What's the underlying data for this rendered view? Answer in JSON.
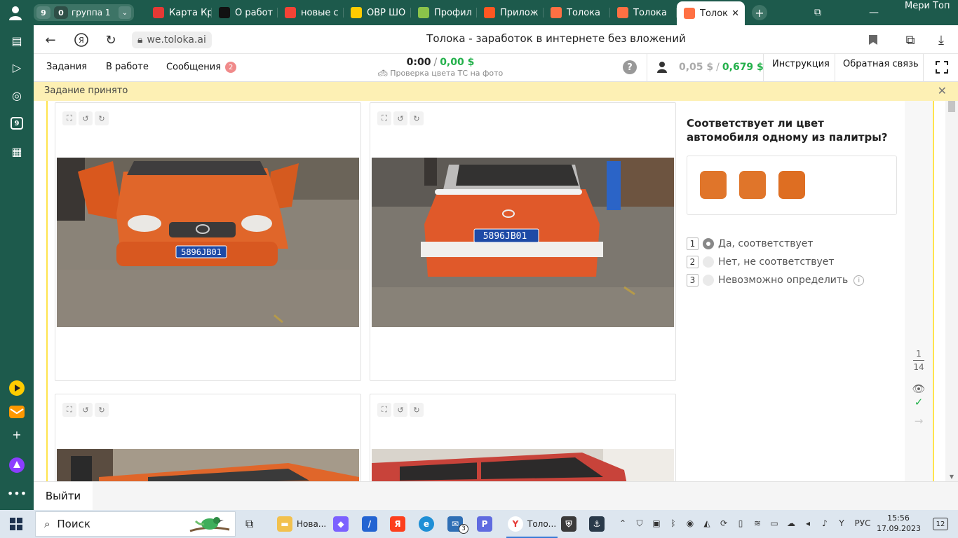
{
  "browser": {
    "profile_name": "Мери Топ",
    "tab_group": {
      "count": "9",
      "tabs_in_group": "0",
      "name": "группа 1"
    },
    "tabs": [
      {
        "label": "Карта Кр",
        "favicon": "map-pin-icon",
        "color": "#e53935"
      },
      {
        "label": "О работ",
        "favicon": "star-icon",
        "color": "#111111"
      },
      {
        "label": "новые с",
        "favicon": "yandex-icon",
        "color": "#f44336"
      },
      {
        "label": "ОВР ШО",
        "favicon": "play-icon",
        "color": "#ffcc00"
      },
      {
        "label": "Профил",
        "favicon": "question-icon",
        "color": "#8bc34a"
      },
      {
        "label": "Прилож",
        "favicon": "toloka-icon",
        "color": "#ff5722"
      },
      {
        "label": "Толока",
        "favicon": "toloka-icon",
        "color": "#ff7043"
      },
      {
        "label": "Толока",
        "favicon": "toloka-icon",
        "color": "#ff7043"
      },
      {
        "label": "Толок",
        "favicon": "toloka-icon",
        "color": "#ff7043",
        "active": true
      }
    ],
    "address": {
      "domain": "we.toloka.ai",
      "page_title": "Толока - заработок в интернете без вложений"
    },
    "rail_badge": "9"
  },
  "toloka": {
    "nav": {
      "tasks": "Задания",
      "in_work": "В работе",
      "messages": "Сообщения",
      "messages_count": "2"
    },
    "timer": {
      "time": "0:00",
      "separator": "/",
      "reward": "0,00 $",
      "task_name": "Проверка цвета ТС на фото"
    },
    "balance": {
      "pending": "0,05 $",
      "separator": "/",
      "available": "0,679 $"
    },
    "links": {
      "instruction": "Инструкция",
      "feedback": "Обратная связь"
    },
    "notice": "Задание принято",
    "question": "Соответствует ли цвет автомобиля одному из палитры?",
    "palette": [
      "#e0752a",
      "#e0752a",
      "#de6e22"
    ],
    "options": [
      {
        "key": "1",
        "label": "Да, соответствует",
        "selected": true
      },
      {
        "key": "2",
        "label": "Нет, не соответствует",
        "selected": false
      },
      {
        "key": "3",
        "label": "Невозможно определить",
        "selected": false,
        "info": "i"
      }
    ],
    "plates": [
      "5896JB01",
      "5896JB01"
    ],
    "pagination": {
      "current": "1",
      "total": "14"
    },
    "exit": "Выйти"
  },
  "taskbar": {
    "search": "Поиск",
    "apps": [
      {
        "label": "Нова...",
        "icon": "folder-icon"
      },
      {
        "label": "Толо...",
        "icon": "yandex-browser-icon"
      }
    ],
    "mail_count": "3",
    "clock": {
      "time": "15:56",
      "date": "17.09.2023"
    },
    "lang": "РУС",
    "notifications": "12"
  }
}
